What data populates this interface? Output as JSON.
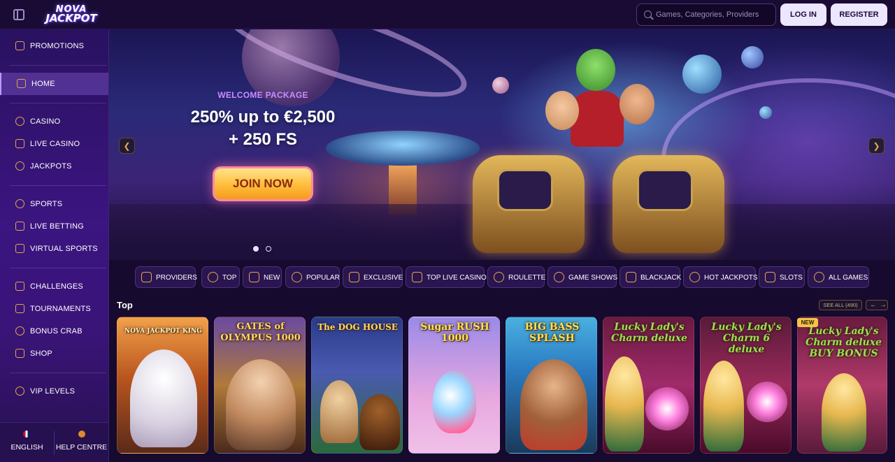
{
  "header": {
    "logo_line1": "NOVA",
    "logo_line2": "JACKPOT",
    "search_placeholder": "Games, Categories, Providers",
    "login_label": "LOG IN",
    "register_label": "REGISTER"
  },
  "sidebar": {
    "items": [
      {
        "label": "PROMOTIONS",
        "icon": "promotions-icon"
      },
      {
        "label": "HOME",
        "icon": "home-icon",
        "active": true
      },
      {
        "label": "CASINO",
        "icon": "casino-chip-icon"
      },
      {
        "label": "LIVE CASINO",
        "icon": "live-casino-icon"
      },
      {
        "label": "JACKPOTS",
        "icon": "jackpot-seven-icon"
      },
      {
        "label": "SPORTS",
        "icon": "sports-ball-icon"
      },
      {
        "label": "LIVE BETTING",
        "icon": "live-betting-icon"
      },
      {
        "label": "VIRTUAL SPORTS",
        "icon": "gamepad-icon"
      },
      {
        "label": "CHALLENGES",
        "icon": "challenges-icon"
      },
      {
        "label": "TOURNAMENTS",
        "icon": "trophy-icon"
      },
      {
        "label": "BONUS CRAB",
        "icon": "crab-icon"
      },
      {
        "label": "SHOP",
        "icon": "shop-bag-icon"
      },
      {
        "label": "VIP LEVELS",
        "icon": "diamond-icon"
      }
    ],
    "footer": {
      "language_label": "ENGLISH",
      "help_label": "HELP CENTRE"
    }
  },
  "hero": {
    "eyebrow": "WELCOME PACKAGE",
    "headline_line1": "250% up to €2,500",
    "headline_line2": "+ 250 FS",
    "cta_label": "JOIN NOW",
    "slide_count": 2,
    "active_slide": 1
  },
  "categories": [
    {
      "label": "PROVIDERS",
      "icon": "providers-grid-icon"
    },
    {
      "label": "TOP",
      "icon": "top-medal-icon"
    },
    {
      "label": "NEW",
      "icon": "rocket-icon"
    },
    {
      "label": "POPULAR",
      "icon": "flame-icon"
    },
    {
      "label": "EXCLUSIVE",
      "icon": "gem-icon"
    },
    {
      "label": "TOP LIVE CASINO",
      "icon": "star-icon"
    },
    {
      "label": "ROULETTE",
      "icon": "roulette-icon"
    },
    {
      "label": "GAME SHOWS",
      "icon": "wheel-icon"
    },
    {
      "label": "BLACKJACK",
      "icon": "spade-icon"
    },
    {
      "label": "HOT JACKPOTS",
      "icon": "horseshoe-icon"
    },
    {
      "label": "SLOTS",
      "icon": "slot-machine-icon"
    },
    {
      "label": "ALL GAMES",
      "icon": "cherries-icon"
    }
  ],
  "top_section": {
    "title": "Top",
    "see_all_label": "SEE ALL (490)",
    "games": [
      {
        "title": "NOVA JACKPOT KING",
        "badge": ""
      },
      {
        "title": "GATES of OLYMPUS 1000",
        "badge": ""
      },
      {
        "title": "The DOG HOUSE",
        "badge": ""
      },
      {
        "title": "Sugar RUSH 1000",
        "badge": ""
      },
      {
        "title": "BIG BASS SPLASH",
        "badge": ""
      },
      {
        "title": "Lucky Lady's Charm deluxe",
        "badge": ""
      },
      {
        "title": "Lucky Lady's Charm 6 deluxe",
        "badge": ""
      },
      {
        "title": "Lucky Lady's Charm deluxe BUY BONUS",
        "badge": "NEW"
      }
    ]
  },
  "colors": {
    "accent_gold": "#e0a94a",
    "background": "#160a2e",
    "sidebar": "#3b1580",
    "welcome_purple": "#c98cff",
    "cta_gold": "#ffbd3a"
  }
}
